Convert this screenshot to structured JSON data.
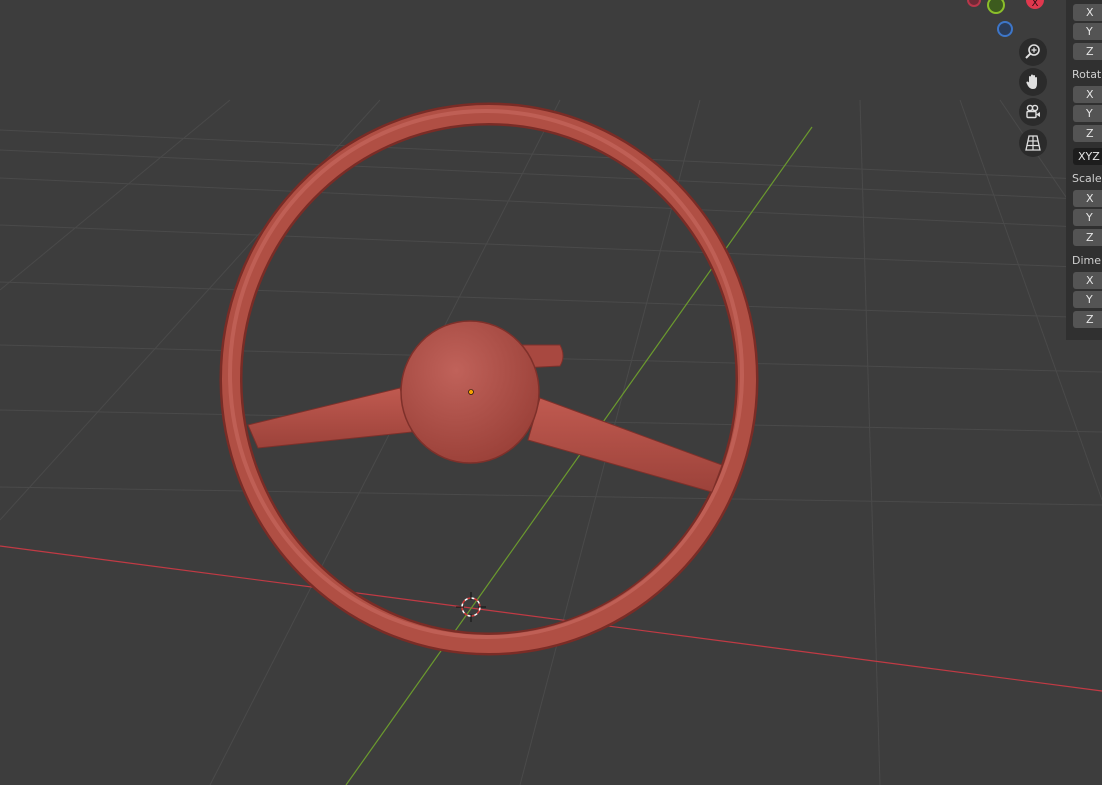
{
  "viewport": {
    "object_color": "#b04f44",
    "axis_x_color": "#c13a44",
    "axis_y_color": "#6b9a2e",
    "grid_color": "#4a4a4a",
    "background": "#3d3d3d"
  },
  "gizmo": {
    "x_label": "X",
    "colors": {
      "x": "#e0384e",
      "y": "#8bbf2a",
      "z": "#3d76c9"
    }
  },
  "nav_buttons": [
    {
      "name": "zoom-icon"
    },
    {
      "name": "hand-pan-icon"
    },
    {
      "name": "camera-view-icon"
    },
    {
      "name": "grid-perspective-icon"
    }
  ],
  "properties": {
    "location": {
      "x": "X",
      "y": "Y",
      "z": "Z"
    },
    "rotation": {
      "label": "Rotati",
      "x": "X",
      "y": "Y",
      "z": "Z",
      "mode": "XYZ"
    },
    "scale": {
      "label": "Scale:",
      "x": "X",
      "y": "Y",
      "z": "Z"
    },
    "dimensions": {
      "label": "Dimer",
      "x": "X",
      "y": "Y",
      "z": "Z"
    }
  }
}
